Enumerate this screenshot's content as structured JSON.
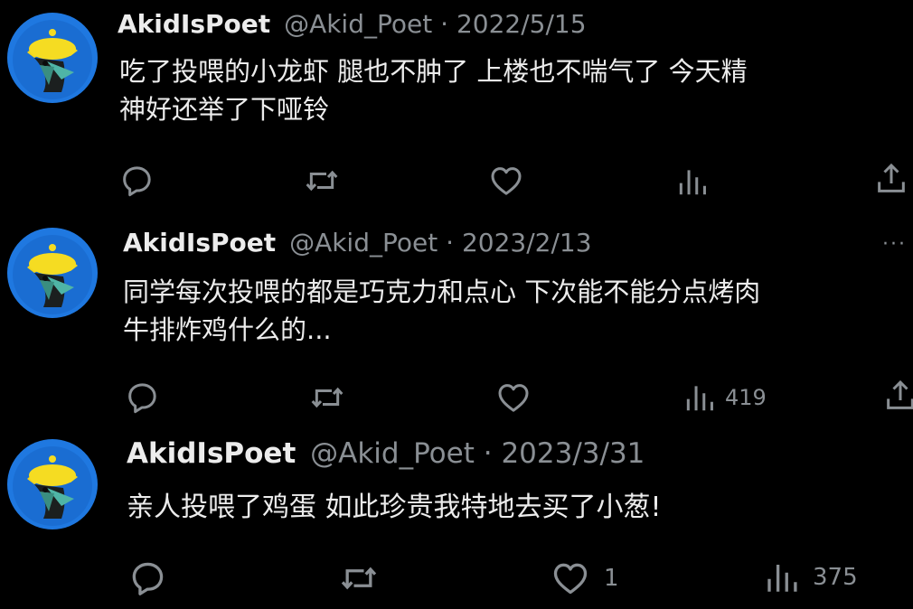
{
  "colors": {
    "background": "#000000",
    "text": "#ececec",
    "muted": "#8a8f94",
    "avatar_bg": "#1f78e0",
    "avatar_hat": "#f2d51c"
  },
  "tweets": [
    {
      "display_name": "AkidIsPoet",
      "handle": "@Akid_Poet",
      "separator": "·",
      "date": "2022/5/15",
      "text": "吃了投喂的小龙虾 腿也不肿了 上楼也不喘气了 今天精\n神好还举了下哑铃",
      "like_count": "",
      "view_count": "",
      "icons": [
        "reply-icon",
        "retweet-icon",
        "like-icon",
        "views-icon",
        "share-icon"
      ]
    },
    {
      "display_name": "AkidIsPoet",
      "handle": "@Akid_Poet",
      "separator": "·",
      "date": "2023/2/13",
      "more": "···",
      "text": "同学每次投喂的都是巧克力和点心 下次能不能分点烤肉\n牛排炸鸡什么的...",
      "like_count": "",
      "view_count": "419",
      "icons": [
        "reply-icon",
        "retweet-icon",
        "like-icon",
        "views-icon",
        "share-icon"
      ]
    },
    {
      "display_name": "AkidIsPoet",
      "handle": "@Akid_Poet",
      "separator": "·",
      "date": "2023/3/31",
      "text": "亲人投喂了鸡蛋 如此珍贵我特地去买了小葱!",
      "like_count": "1",
      "view_count": "375",
      "icons": [
        "reply-icon",
        "retweet-icon",
        "like-icon",
        "views-icon"
      ]
    }
  ]
}
